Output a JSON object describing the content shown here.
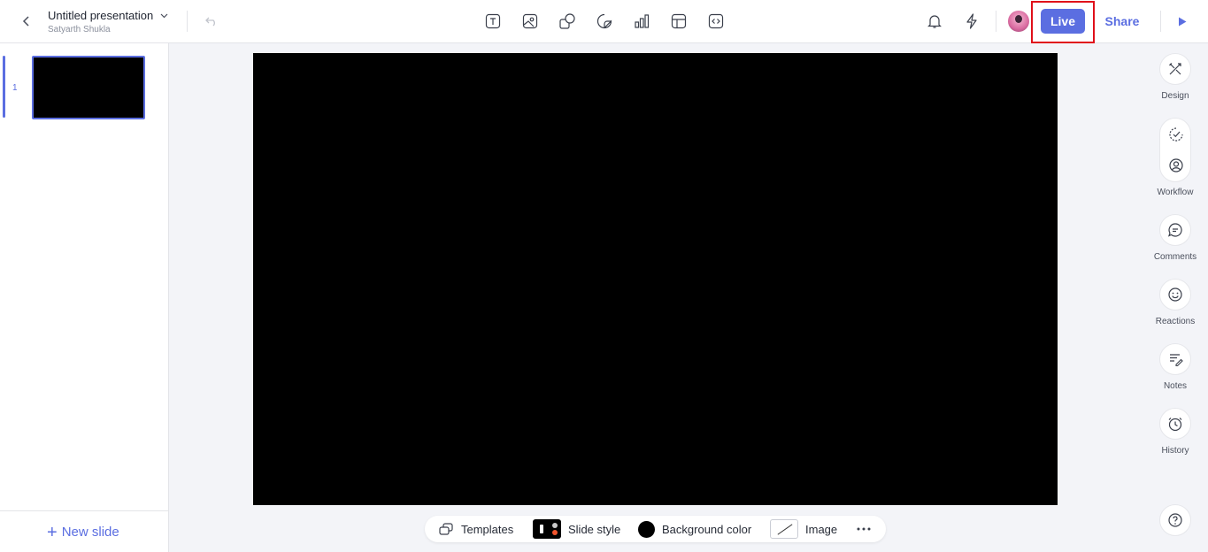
{
  "header": {
    "title": "Untitled presentation",
    "owner": "Satyarth Shukla",
    "live_label": "Live",
    "share_label": "Share",
    "insert_tools": [
      "text-icon",
      "image-icon",
      "shape-icon",
      "sticker-icon",
      "chart-icon",
      "table-icon",
      "embed-icon"
    ]
  },
  "slides": [
    {
      "number": "1",
      "background": "#000000"
    }
  ],
  "sidebar": {
    "new_slide_label": "New slide"
  },
  "bottom_toolbar": {
    "templates_label": "Templates",
    "slide_style_label": "Slide style",
    "background_color_label": "Background color",
    "background_color": "#000000",
    "image_label": "Image"
  },
  "right_rail": {
    "design_label": "Design",
    "workflow_label": "Workflow",
    "comments_label": "Comments",
    "reactions_label": "Reactions",
    "notes_label": "Notes",
    "history_label": "History"
  },
  "colors": {
    "accent": "#5b6ee1",
    "highlight": "#e0101a"
  }
}
